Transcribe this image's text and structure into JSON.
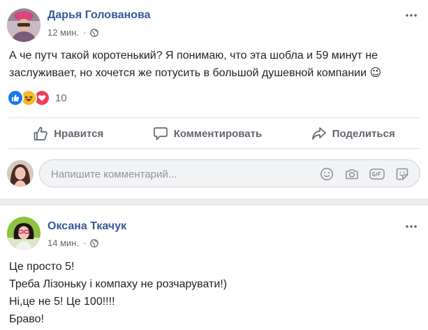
{
  "post1": {
    "author": "Дарья Голованова",
    "time": "12 мин.",
    "privacy_icon": "globe-icon",
    "text_lines": [
      "А че путч такой коротенький? Я понимаю, что эта шобла и 59 минут не",
      "заслуживает, но хочется же потусить в большой душевной компании 😉"
    ],
    "reactions": {
      "icons": [
        "like-icon",
        "haha-icon",
        "love-icon"
      ],
      "count": "10"
    },
    "actions": {
      "like": "Нравится",
      "comment": "Комментировать",
      "share": "Поделиться"
    },
    "comment_box": {
      "placeholder": "Напишите комментарий...",
      "tools": [
        "emoji-icon",
        "camera-icon",
        "gif-icon",
        "sticker-icon"
      ]
    }
  },
  "post2": {
    "author": "Оксана Ткачук",
    "time": "14 мин.",
    "privacy_icon": "globe-icon",
    "text_lines": [
      "Це просто 5!",
      "Треба Лізоньку і компаху не розчарувати!)",
      "Ні,це не 5! Це 100!!!!",
      "Браво!"
    ]
  },
  "colors": {
    "author": "#365899",
    "like_blue": "#1877f2",
    "love_red": "#f33e58",
    "haha_yellow": "#f7b928",
    "background": "#e9ebee"
  }
}
